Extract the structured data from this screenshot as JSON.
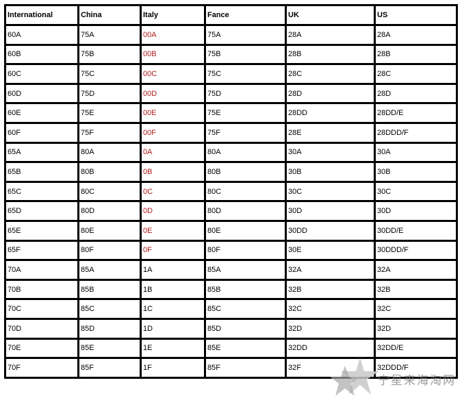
{
  "table": {
    "headers": [
      "International",
      "China",
      "Italy",
      "Fance",
      "UK",
      "US"
    ],
    "rows": [
      [
        "60A",
        "75A",
        "00A",
        "75A",
        "28A",
        "28A"
      ],
      [
        "60B",
        "75B",
        "00B",
        "75B",
        "28B",
        "28B"
      ],
      [
        "60C",
        "75C",
        "00C",
        "75C",
        "28C",
        "28C"
      ],
      [
        "60D",
        "75D",
        "00D",
        "75D",
        "28D",
        "28D"
      ],
      [
        "60E",
        "75E",
        "00E",
        "75E",
        "28DD",
        "28DD/E"
      ],
      [
        "60F",
        "75F",
        "00F",
        "75F",
        "28E",
        "28DDD/F"
      ],
      [
        "65A",
        "80A",
        "0A",
        "80A",
        "30A",
        "30A"
      ],
      [
        "65B",
        "80B",
        "0B",
        "80B",
        "30B",
        "30B"
      ],
      [
        "65C",
        "80C",
        "0C",
        "80C",
        "30C",
        "30C"
      ],
      [
        "65D",
        "80D",
        "0D",
        "80D",
        "30D",
        "30D"
      ],
      [
        "65E",
        "80E",
        "0E",
        "80E",
        "30DD",
        "30DD/E"
      ],
      [
        "65F",
        "80F",
        "0F",
        "80F",
        "30E",
        "30DDD/F"
      ],
      [
        "70A",
        "85A",
        "1A",
        "85A",
        "32A",
        "32A"
      ],
      [
        "70B",
        "85B",
        "1B",
        "85B",
        "32B",
        "32B"
      ],
      [
        "70C",
        "85C",
        "1C",
        "85C",
        "32C",
        "32C"
      ],
      [
        "70D",
        "85D",
        "1D",
        "85D",
        "32D",
        "32D"
      ],
      [
        "70E",
        "85E",
        "1E",
        "85E",
        "32DD",
        "32DD/E"
      ],
      [
        "70F",
        "85F",
        "1F",
        "85F",
        "32F",
        "32DDD/F"
      ]
    ]
  },
  "watermark": {
    "text": "宁星来海淘网",
    "icon": "star-icon"
  },
  "colors": {
    "italy_highlight": "#b01818",
    "border": "#000000"
  }
}
